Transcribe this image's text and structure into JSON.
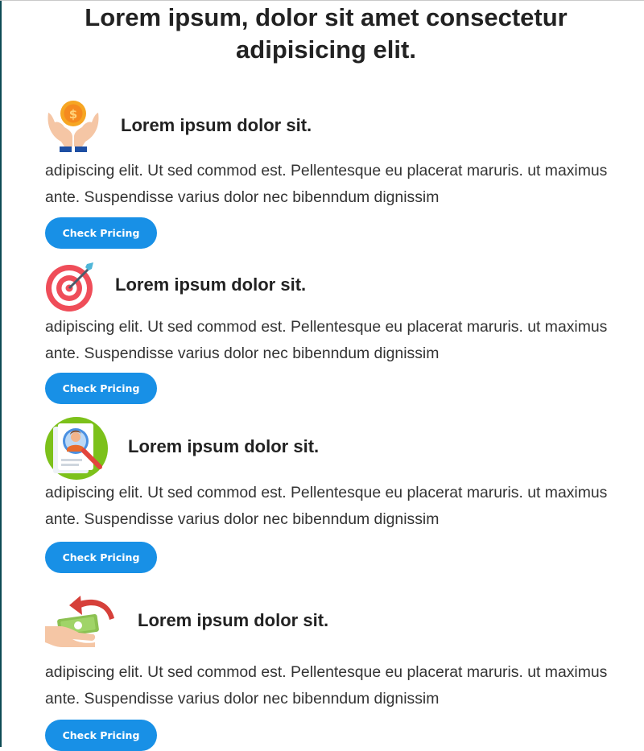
{
  "page": {
    "title": "Lorem ipsum, dolor sit amet consectetur adipisicing elit."
  },
  "features": [
    {
      "heading": "Lorem ipsum dolor sit.",
      "description": "adipiscing elit. Ut sed commod est. Pellentesque eu placerat maruris. ut maximus ante. Suspendisse varius dolor nec bibenndum dignissim",
      "button_label": "Check Pricing",
      "icon": "hands-coin-icon"
    },
    {
      "heading": "Lorem ipsum dolor sit.",
      "description": "adipiscing elit. Ut sed commod est. Pellentesque eu placerat maruris. ut maximus ante. Suspendisse varius dolor nec bibenndum dignissim",
      "button_label": "Check Pricing",
      "icon": "target-dart-icon"
    },
    {
      "heading": "Lorem ipsum dolor sit.",
      "description": "adipiscing elit. Ut sed commod est. Pellentesque eu placerat maruris. ut maximus ante. Suspendisse varius dolor nec bibenndum dignissim",
      "button_label": "Check Pricing",
      "icon": "profile-search-icon"
    },
    {
      "heading": "Lorem ipsum dolor sit.",
      "description": "adipiscing elit. Ut sed commod est. Pellentesque eu placerat maruris. ut maximus ante. Suspendisse varius dolor nec bibenndum dignissim",
      "button_label": "Check Pricing",
      "icon": "money-refund-icon"
    }
  ],
  "colors": {
    "button": "#1890e6",
    "heading_text": "#222222",
    "body_text": "#333333"
  }
}
